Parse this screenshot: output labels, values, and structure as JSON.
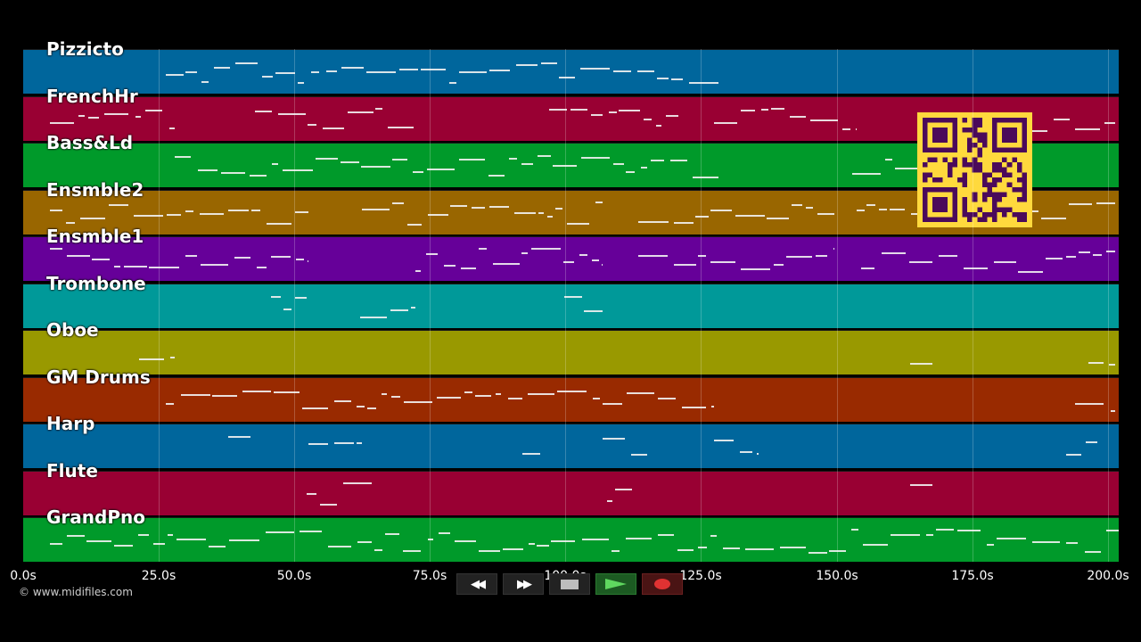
{
  "tracks": [
    {
      "label": "Pizzicto",
      "color": "#00669c"
    },
    {
      "label": "FrenchHr",
      "color": "#990033"
    },
    {
      "label": "Bass&Ld",
      "color": "#009a2a"
    },
    {
      "label": "Ensmble2",
      "color": "#996600"
    },
    {
      "label": "Ensmble1",
      "color": "#660099"
    },
    {
      "label": "Trombone",
      "color": "#009999"
    },
    {
      "label": "Oboe",
      "color": "#999900"
    },
    {
      "label": "GM Drums",
      "color": "#992a00"
    },
    {
      "label": "Harp",
      "color": "#00669c"
    },
    {
      "label": "Flute",
      "color": "#990033"
    },
    {
      "label": "GrandPno",
      "color": "#009a2a"
    }
  ],
  "timeline": {
    "ticks": [
      "0.0s",
      "25.0s",
      "50.0s",
      "75.0s",
      "100.0s",
      "125.0s",
      "150.0s",
      "175.0s",
      "200.0s"
    ]
  },
  "copyright": "© www.midifiles.com",
  "transport": {
    "rewind_icon": "rewind-icon",
    "fastforward_icon": "fast-forward-icon",
    "stop_icon": "stop-icon",
    "play_icon": "play-icon",
    "record_icon": "record-icon"
  },
  "qr": {
    "color": "#ffd93d",
    "module_color": "#4b0a5a"
  }
}
